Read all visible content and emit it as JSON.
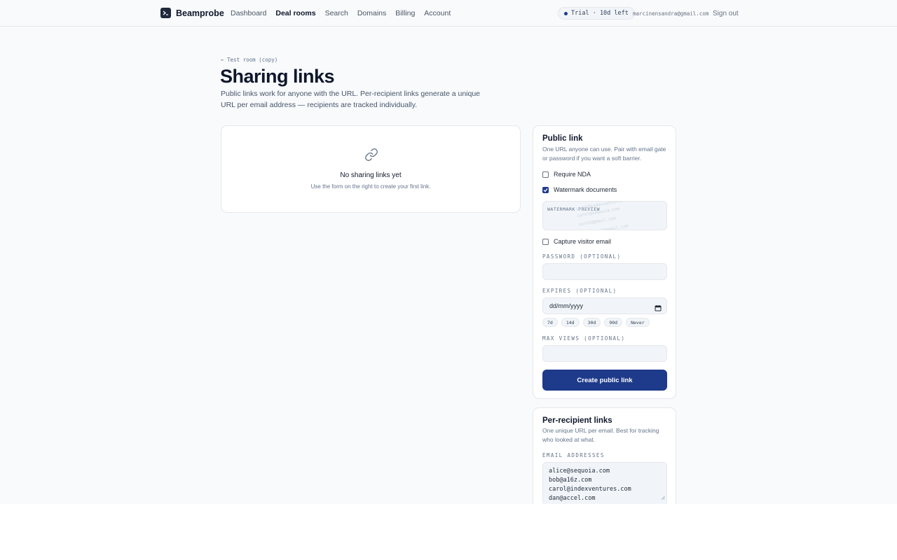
{
  "header": {
    "brand": "Beamprobe",
    "nav": [
      "Dashboard",
      "Deal rooms",
      "Search",
      "Domains",
      "Billing",
      "Account"
    ],
    "active_nav": "Deal rooms",
    "trial": "Trial · 10d left",
    "user_email": "marcinensandra@gmail.com",
    "sign_out": "Sign out"
  },
  "page": {
    "back": "← Test room (copy)",
    "title": "Sharing links",
    "subtitle": "Public links work for anyone with the URL. Per-recipient links generate a unique URL per email address — recipients are tracked individually."
  },
  "empty_state": {
    "title": "No sharing links yet",
    "subtitle": "Use the form on the right to create your first link."
  },
  "public_link": {
    "title": "Public link",
    "description": "One URL anyone can use. Pair with email gate or password if you want a soft barrier.",
    "require_nda": {
      "label": "Require NDA",
      "checked": false
    },
    "watermark": {
      "label": "Watermark documents",
      "checked": true
    },
    "watermark_preview_label": "WATERMARK PREVIEW",
    "watermark_lines": [
      "carol@indexventures.com",
      "carol@sequoia.com",
      "carol@gmail.com",
      "carol@gmail.com"
    ],
    "capture_email": {
      "label": "Capture visitor email",
      "checked": false
    },
    "password_label": "PASSWORD (OPTIONAL)",
    "password_value": "",
    "expires_label": "EXPIRES (OPTIONAL)",
    "expires_value": "dd/mm/yyyy",
    "expiry_chips": [
      "7d",
      "14d",
      "30d",
      "90d",
      "Never"
    ],
    "max_views_label": "MAX VIEWS (OPTIONAL)",
    "max_views_value": "",
    "button": "Create public link"
  },
  "recipient_links": {
    "title": "Per-recipient links",
    "description": "One unique URL per email. Best for tracking who looked at what.",
    "emails_label": "EMAIL ADDRESSES",
    "emails": [
      "alice@sequoia.com",
      "bob@a16z.com",
      "carol@indexventures.com",
      "dan@accel.com"
    ]
  },
  "colors": {
    "accent": "#1e3a8a",
    "background": "#f8fafc",
    "text": "#0f172a"
  }
}
